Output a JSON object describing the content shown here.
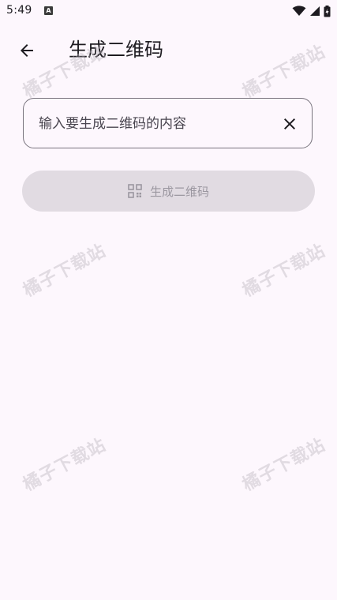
{
  "status_bar": {
    "time": "5:49",
    "notification_icon": "A",
    "icons": [
      "wifi-icon",
      "signal-icon",
      "battery-icon"
    ]
  },
  "app_bar": {
    "back_icon": "arrow-left-icon",
    "title": "生成二维码"
  },
  "input": {
    "placeholder": "输入要生成二维码的内容",
    "value": "",
    "clear_icon": "close-icon"
  },
  "generate_button": {
    "icon": "qr-code-icon",
    "label": "生成二维码",
    "enabled": false
  },
  "watermark": {
    "text": "橘子下载站"
  },
  "colors": {
    "background": "#fdf7fd",
    "text_primary": "#1d1b20",
    "outline": "#79747e",
    "button_disabled_bg": "#e1dbe2",
    "button_disabled_text": "#9b97a0"
  }
}
